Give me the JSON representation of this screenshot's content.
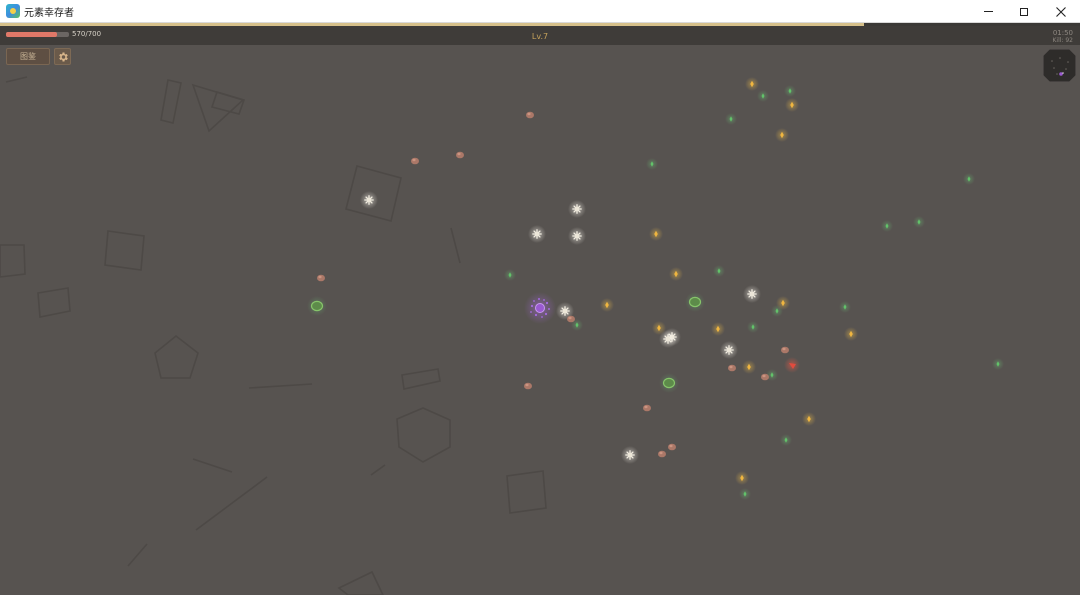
{
  "window": {
    "title": "元素幸存者"
  },
  "hud": {
    "xp_progress": 0.8,
    "hp_current": 570,
    "hp_max": 700,
    "hp_text": "570/700",
    "level_text": "Lv.7",
    "timer_text": "01:50",
    "kill_text": "Kill: 92"
  },
  "buttons": {
    "codex_label": "图鉴",
    "settings_icon": "gear-icon"
  },
  "colors": {
    "background": "#575350",
    "hud_background": "#3f3c39",
    "hp_fill": "#e07868",
    "xp_fill": "#d6c08a",
    "level_text": "#c6a25b",
    "gem_yellow": "#f0b640",
    "gem_green": "#62c26a",
    "enemy_white": "#ece6d8",
    "enemy_brown": "#b57c6a",
    "enemy_green": "#86c46a",
    "player_purple": "#9a5ad0",
    "red_enemy": "#e24b3e"
  }
}
